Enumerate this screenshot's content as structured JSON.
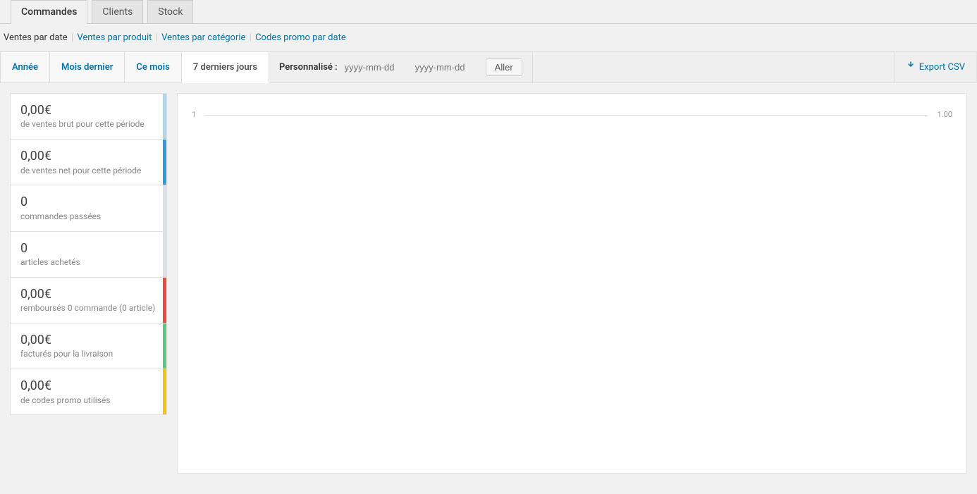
{
  "top_tabs": {
    "commandes": "Commandes",
    "clients": "Clients",
    "stock": "Stock"
  },
  "subnav": {
    "by_date": "Ventes par date",
    "by_product": "Ventes par produit",
    "by_category": "Ventes par catégorie",
    "coupons": "Codes promo par date"
  },
  "range": {
    "year": "Année",
    "last_month": "Mois dernier",
    "this_month": "Ce mois",
    "last_7_days": "7 derniers jours",
    "custom_label": "Personnalisé :",
    "date_placeholder": "yyyy-mm-dd",
    "go": "Aller",
    "export": "Export CSV"
  },
  "summaries": [
    {
      "value": "0,00€",
      "desc": "de ventes brut pour cette période",
      "class": "c-lightblue"
    },
    {
      "value": "0,00€",
      "desc": "de ventes net pour cette période",
      "class": "c-blue"
    },
    {
      "value": "0",
      "desc": "commandes passées",
      "class": "c-gray"
    },
    {
      "value": "0",
      "desc": "articles achetés",
      "class": "c-gray"
    },
    {
      "value": "0,00€",
      "desc": "remboursés 0 commande (0 article)",
      "class": "c-red"
    },
    {
      "value": "0,00€",
      "desc": "facturés pour la livraison",
      "class": "c-green"
    },
    {
      "value": "0,00€",
      "desc": "de codes promo utilisés",
      "class": "c-yellow"
    }
  ],
  "chart": {
    "tick_left": "1",
    "tick_right": "1.00"
  },
  "chart_data": {
    "type": "line",
    "title": "",
    "xlabel": "",
    "ylabel": "",
    "ylim": [
      1,
      1
    ],
    "series": [],
    "note": "Chart is empty for this period"
  }
}
